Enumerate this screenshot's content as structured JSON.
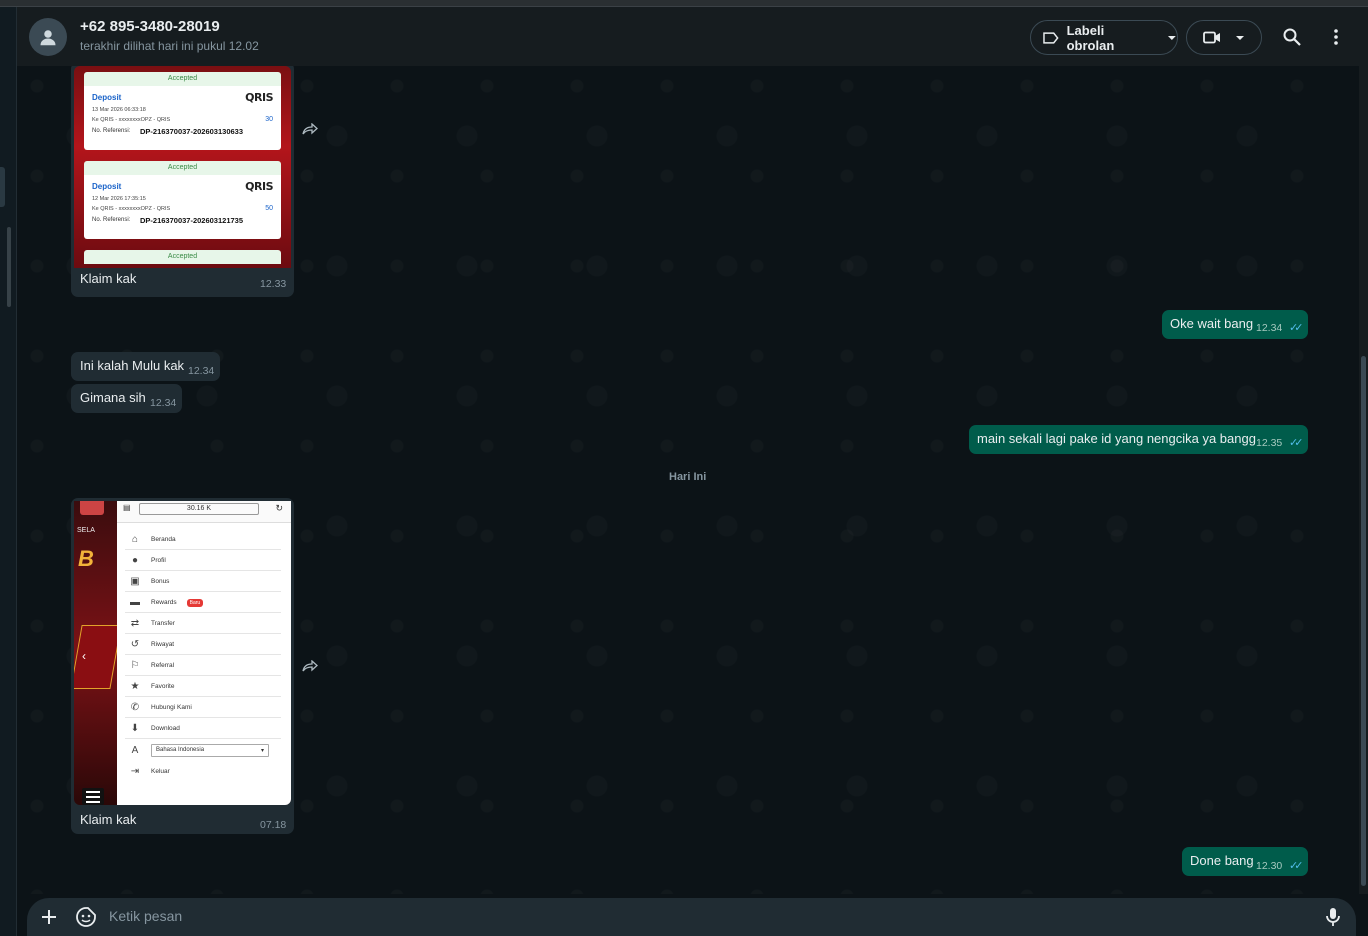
{
  "header": {
    "contact_name": "+62 895-3480-28019",
    "last_seen": "terakhir dilihat hari ini pukul 12.02",
    "label_button": "Labeli obrolan",
    "icons": [
      "video-icon",
      "search-icon",
      "more-options-icon"
    ]
  },
  "messages": {
    "m1": {
      "direction": "incoming",
      "caption": "Klaim kak",
      "time": "12.33",
      "receipts": [
        {
          "status": "Accepted",
          "type": "Deposit",
          "logo": "QRIS",
          "datetime": "13 Mar 2026 06:33:18",
          "dest": "Ke QRIS - xxxxxxxxOPZ - QRIS",
          "amount": "30",
          "ref_label": "No. Referensi:",
          "ref": "DP-216370037-202603130633"
        },
        {
          "status": "Accepted",
          "type": "Deposit",
          "logo": "QRIS",
          "datetime": "12 Mar 2026 17:35:15",
          "dest": "Ke QRIS - xxxxxxxxOPZ - QRIS",
          "amount": "50",
          "ref_label": "No. Referensi:",
          "ref": "DP-216370037-202603121735"
        },
        {
          "status": "Accepted"
        }
      ]
    },
    "m2": {
      "direction": "outgoing",
      "text": "Oke wait bang",
      "time": "12.34"
    },
    "m3": {
      "direction": "incoming",
      "text": "Ini kalah Mulu kak",
      "time": "12.34"
    },
    "m4": {
      "direction": "incoming",
      "text": "Gimana sih",
      "time": "12.34"
    },
    "m5": {
      "direction": "outgoing",
      "text": "main sekali lagi pake id yang nengcika ya bangg",
      "time": "12.35"
    },
    "date_divider": "Hari Ini",
    "m6": {
      "direction": "incoming",
      "caption": "Klaim kak",
      "time": "07.18",
      "screenshot": {
        "balance": "30.16 K",
        "menu": [
          "Beranda",
          "Profil",
          "Bonus",
          "Rewards",
          "Transfer",
          "Riwayat",
          "Referral",
          "Favorite",
          "Hubungi Kami",
          "Download",
          "Bahasa Indonesia",
          "Keluar"
        ],
        "badge": "Baru",
        "banner_text": "SELA"
      }
    },
    "m7": {
      "direction": "outgoing",
      "text": "Done bang",
      "time": "12.30"
    }
  },
  "composer": {
    "placeholder": "Ketik pesan",
    "icons": [
      "plus-icon",
      "sticker-icon",
      "microphone-icon"
    ]
  },
  "colors": {
    "outgoing": "#005c4b",
    "incoming": "#202c33",
    "read_tick": "#53bdeb"
  }
}
